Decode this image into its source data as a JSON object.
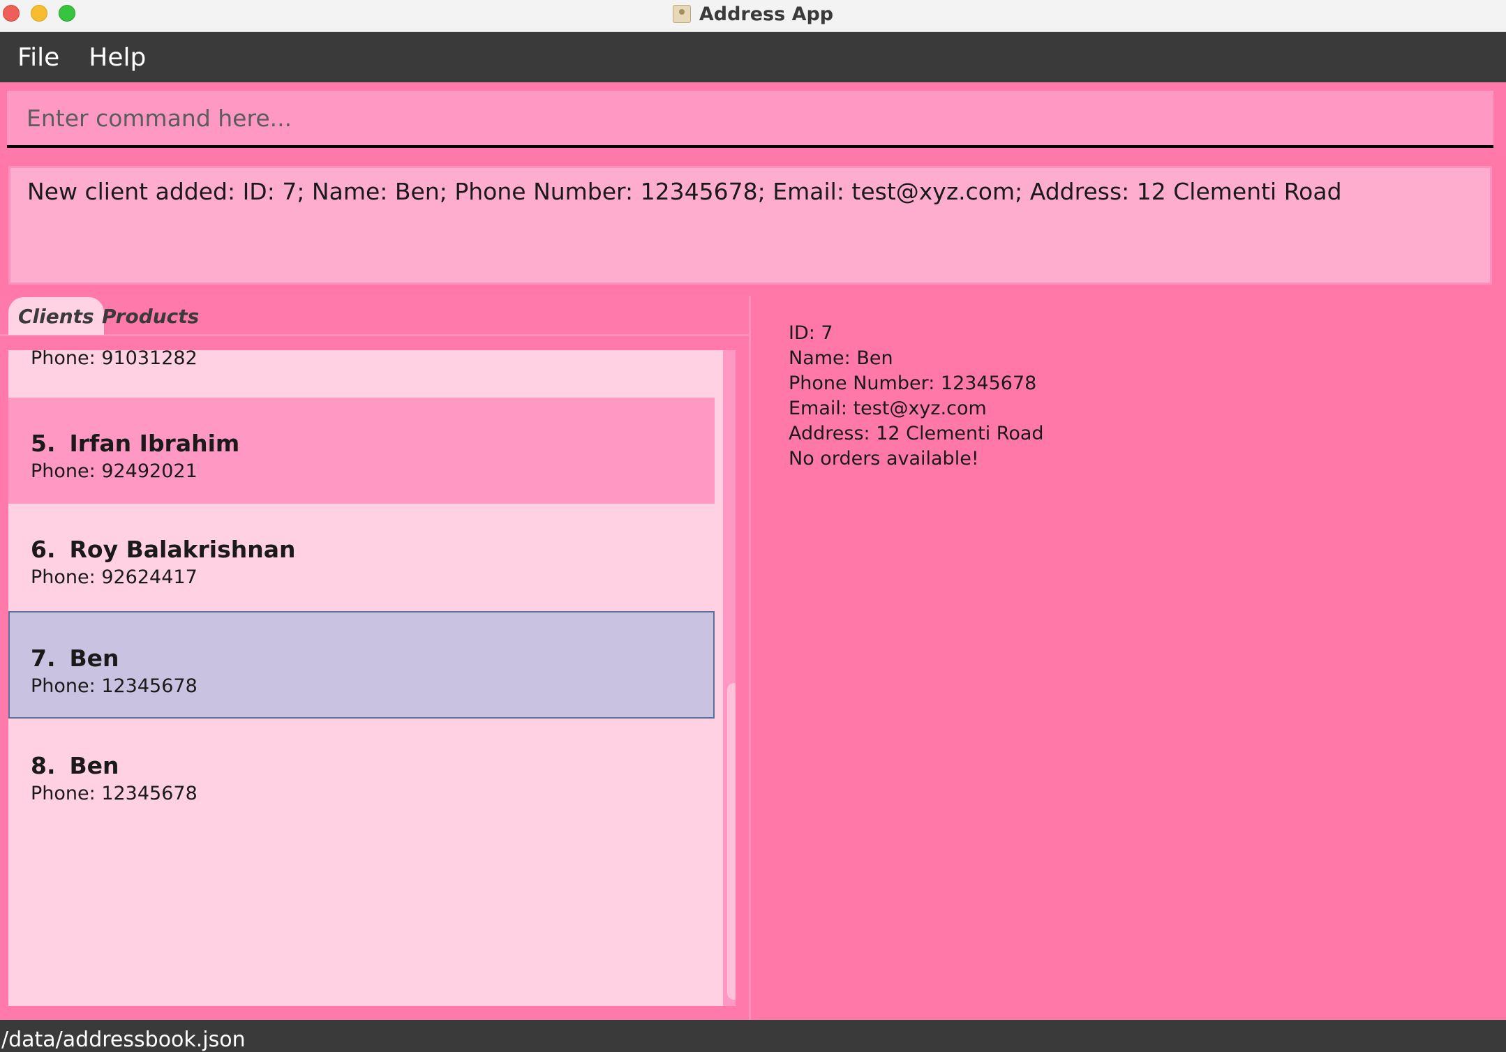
{
  "window": {
    "title": "Address App"
  },
  "menu": {
    "file": "File",
    "help": "Help"
  },
  "command": {
    "placeholder": "Enter command here..."
  },
  "result": {
    "message": "New client added: ID: 7; Name: Ben; Phone Number: 12345678; Email: test@xyz.com; Address: 12 Clementi Road"
  },
  "tabs": {
    "clients": "Clients",
    "products": "Products"
  },
  "client_list": {
    "partial_card_phone": "Phone: 91031282",
    "cards": [
      {
        "index": "5.",
        "name": "Irfan Ibrahim",
        "phone": "Phone: 92492021"
      },
      {
        "index": "6.",
        "name": "Roy Balakrishnan",
        "phone": "Phone: 92624417"
      },
      {
        "index": "7.",
        "name": "Ben",
        "phone": "Phone: 12345678"
      },
      {
        "index": "8.",
        "name": "Ben",
        "phone": "Phone: 12345678"
      }
    ]
  },
  "details": {
    "id": "ID: 7",
    "name": "Name: Ben",
    "phone": "Phone Number: 12345678",
    "email": "Email: test@xyz.com",
    "address": "Address: 12 Clementi Road",
    "orders": "No orders available!"
  },
  "status": {
    "path": "/data/addressbook.json"
  },
  "colors": {
    "background": "#ff78a8",
    "menu_bar": "#3a3a3a",
    "selected_card": "#c9c3e1",
    "card": "#ffd1e3",
    "card_alt": "#ff99c4"
  }
}
